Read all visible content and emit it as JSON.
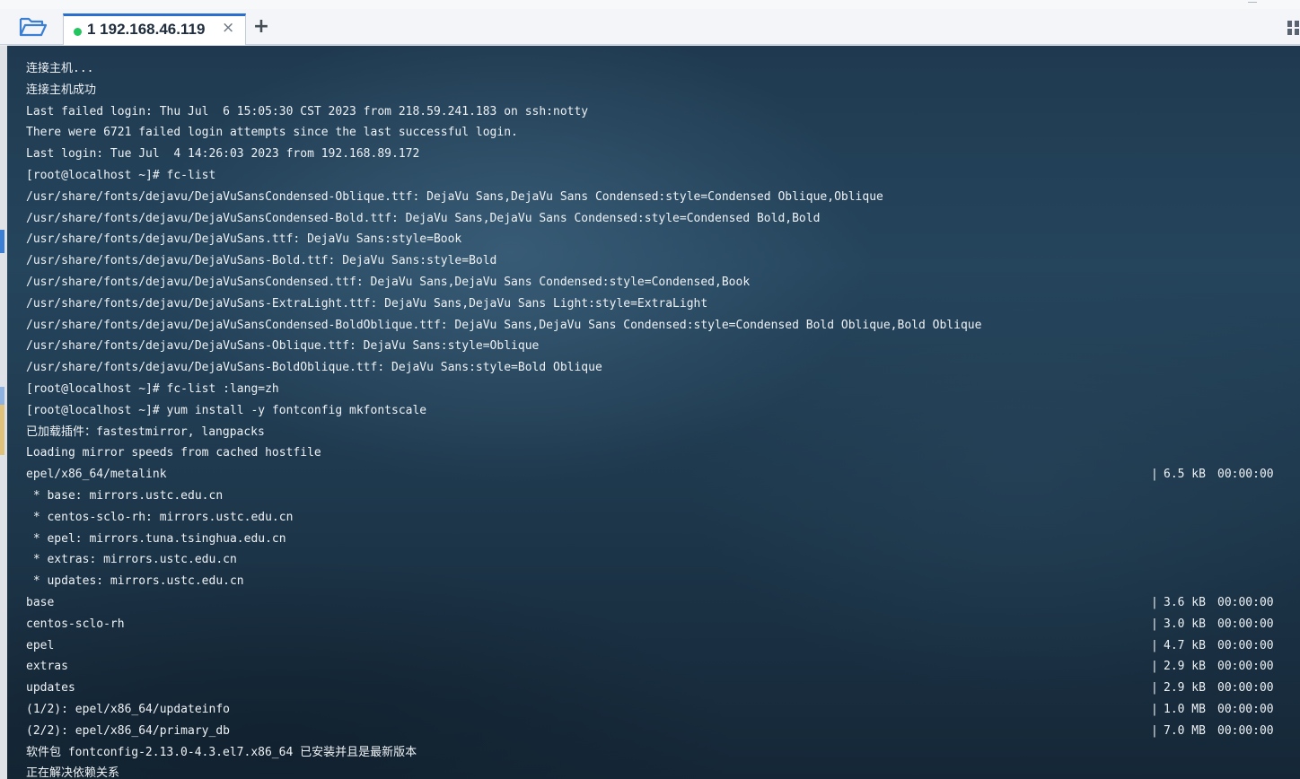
{
  "window": {
    "tab_title": "1 192.168.46.119",
    "tab_status_color": "#22c55e",
    "tab_close_glyph": "×",
    "add_tab_glyph": "+",
    "accent_color": "#2b6fce"
  },
  "terminal": {
    "lines": [
      {
        "text": "连接主机..."
      },
      {
        "text": "连接主机成功"
      },
      {
        "text": "Last failed login: Thu Jul  6 15:05:30 CST 2023 from 218.59.241.183 on ssh:notty"
      },
      {
        "text": "There were 6721 failed login attempts since the last successful login."
      },
      {
        "text": "Last login: Tue Jul  4 14:26:03 2023 from 192.168.89.172"
      },
      {
        "text": "[root@localhost ~]# fc-list"
      },
      {
        "text": "/usr/share/fonts/dejavu/DejaVuSansCondensed-Oblique.ttf: DejaVu Sans,DejaVu Sans Condensed:style=Condensed Oblique,Oblique"
      },
      {
        "text": "/usr/share/fonts/dejavu/DejaVuSansCondensed-Bold.ttf: DejaVu Sans,DejaVu Sans Condensed:style=Condensed Bold,Bold"
      },
      {
        "text": "/usr/share/fonts/dejavu/DejaVuSans.ttf: DejaVu Sans:style=Book"
      },
      {
        "text": "/usr/share/fonts/dejavu/DejaVuSans-Bold.ttf: DejaVu Sans:style=Bold"
      },
      {
        "text": "/usr/share/fonts/dejavu/DejaVuSansCondensed.ttf: DejaVu Sans,DejaVu Sans Condensed:style=Condensed,Book"
      },
      {
        "text": "/usr/share/fonts/dejavu/DejaVuSans-ExtraLight.ttf: DejaVu Sans,DejaVu Sans Light:style=ExtraLight"
      },
      {
        "text": "/usr/share/fonts/dejavu/DejaVuSansCondensed-BoldOblique.ttf: DejaVu Sans,DejaVu Sans Condensed:style=Condensed Bold Oblique,Bold Oblique"
      },
      {
        "text": "/usr/share/fonts/dejavu/DejaVuSans-Oblique.ttf: DejaVu Sans:style=Oblique"
      },
      {
        "text": "/usr/share/fonts/dejavu/DejaVuSans-BoldOblique.ttf: DejaVu Sans:style=Bold Oblique"
      },
      {
        "text": "[root@localhost ~]# fc-list :lang=zh"
      },
      {
        "text": "[root@localhost ~]# yum install -y fontconfig mkfontscale"
      },
      {
        "text": "已加载插件：fastestmirror, langpacks"
      },
      {
        "text": "Loading mirror speeds from cached hostfile"
      },
      {
        "text": "epel/x86_64/metalink",
        "sep": "|",
        "size": "6.5 kB",
        "time": "00:00:00"
      },
      {
        "text": " * base: mirrors.ustc.edu.cn"
      },
      {
        "text": " * centos-sclo-rh: mirrors.ustc.edu.cn"
      },
      {
        "text": " * epel: mirrors.tuna.tsinghua.edu.cn"
      },
      {
        "text": " * extras: mirrors.ustc.edu.cn"
      },
      {
        "text": " * updates: mirrors.ustc.edu.cn"
      },
      {
        "text": "base",
        "sep": "|",
        "size": "3.6 kB",
        "time": "00:00:00"
      },
      {
        "text": "centos-sclo-rh",
        "sep": "|",
        "size": "3.0 kB",
        "time": "00:00:00"
      },
      {
        "text": "epel",
        "sep": "|",
        "size": "4.7 kB",
        "time": "00:00:00"
      },
      {
        "text": "extras",
        "sep": "|",
        "size": "2.9 kB",
        "time": "00:00:00"
      },
      {
        "text": "updates",
        "sep": "|",
        "size": "2.9 kB",
        "time": "00:00:00"
      },
      {
        "text": "(1/2): epel/x86_64/updateinfo",
        "sep": "|",
        "size": "1.0 MB",
        "time": "00:00:00"
      },
      {
        "text": "(2/2): epel/x86_64/primary_db",
        "sep": "|",
        "size": "7.0 MB",
        "time": "00:00:00"
      },
      {
        "text": "软件包 fontconfig-2.13.0-4.3.el7.x86_64 已安装并且是最新版本"
      },
      {
        "text": "正在解决依赖关系"
      }
    ]
  }
}
